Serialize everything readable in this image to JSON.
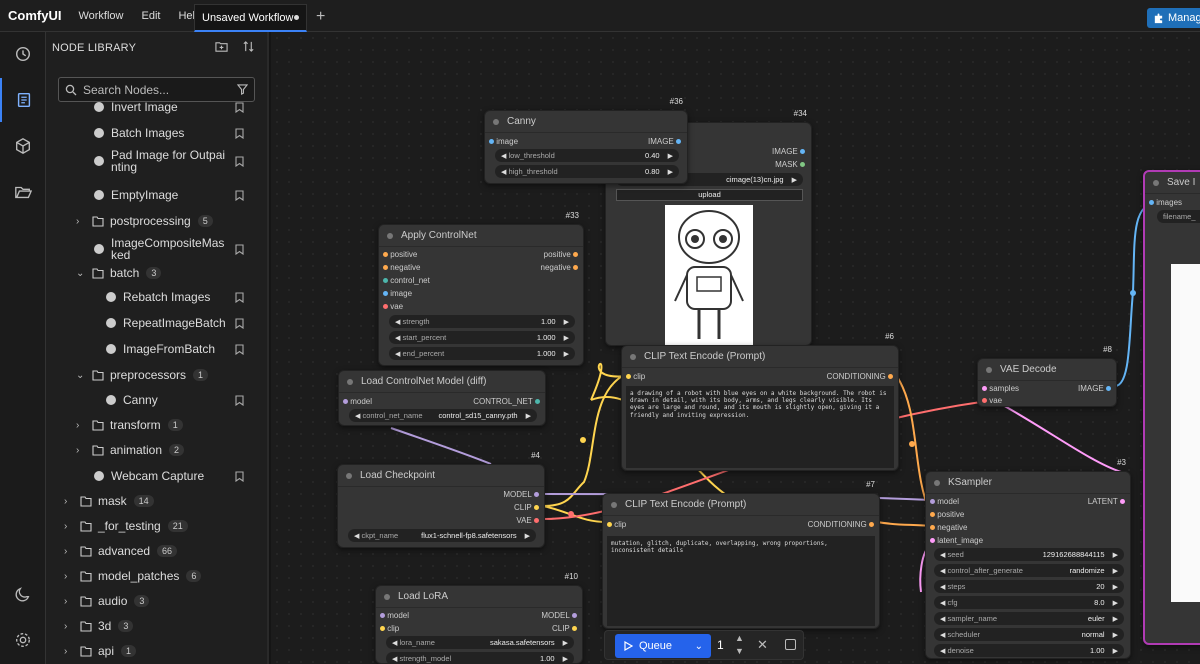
{
  "topbar": {
    "brand": "ComfyUI",
    "menus": [
      "Workflow",
      "Edit",
      "Help"
    ],
    "tab": "Unsaved Workflow",
    "add": "+",
    "manager": "Manag"
  },
  "library": {
    "title": "NODE LIBRARY",
    "search_placeholder": "Search Nodes...",
    "items": [
      {
        "label": "Invert Image",
        "indent": 1,
        "kind": "node"
      },
      {
        "label": "Batch Images",
        "indent": 1,
        "kind": "node"
      },
      {
        "label": "Pad Image for Outpainting",
        "indent": 1,
        "kind": "node",
        "two_line": [
          "Pad Image for Outpai",
          "nting"
        ]
      },
      {
        "label": "EmptyImage",
        "indent": 1,
        "kind": "node"
      },
      {
        "label": "postprocessing",
        "indent": 1,
        "kind": "folder",
        "open": false,
        "count": "5"
      },
      {
        "label": "ImageCompositeMasked",
        "indent": 1,
        "kind": "node",
        "two_line": [
          "ImageCompositeMas",
          "ked"
        ]
      },
      {
        "label": "batch",
        "indent": 1,
        "kind": "folder",
        "open": true,
        "count": "3"
      },
      {
        "label": "Rebatch Images",
        "indent": 2,
        "kind": "node"
      },
      {
        "label": "RepeatImageBatch",
        "indent": 2,
        "kind": "node"
      },
      {
        "label": "ImageFromBatch",
        "indent": 2,
        "kind": "node"
      },
      {
        "label": "preprocessors",
        "indent": 1,
        "kind": "folder",
        "open": true,
        "count": "1"
      },
      {
        "label": "Canny",
        "indent": 2,
        "kind": "node"
      },
      {
        "label": "transform",
        "indent": 1,
        "kind": "folder",
        "open": false,
        "count": "1"
      },
      {
        "label": "animation",
        "indent": 1,
        "kind": "folder",
        "open": false,
        "count": "2"
      },
      {
        "label": "Webcam Capture",
        "indent": 1,
        "kind": "node"
      },
      {
        "label": "mask",
        "indent": 0,
        "kind": "folder",
        "open": false,
        "count": "14"
      },
      {
        "label": "_for_testing",
        "indent": 0,
        "kind": "folder",
        "open": false,
        "count": "21"
      },
      {
        "label": "advanced",
        "indent": 0,
        "kind": "folder",
        "open": false,
        "count": "66"
      },
      {
        "label": "model_patches",
        "indent": 0,
        "kind": "folder",
        "open": false,
        "count": "6"
      },
      {
        "label": "audio",
        "indent": 0,
        "kind": "folder",
        "open": false,
        "count": "3"
      },
      {
        "label": "3d",
        "indent": 0,
        "kind": "folder",
        "open": false,
        "count": "3"
      },
      {
        "label": "api",
        "indent": 0,
        "kind": "folder",
        "open": false,
        "count": "1"
      }
    ]
  },
  "nodes": {
    "canny": {
      "id": "#36",
      "title": "Canny",
      "in": "image",
      "out": "IMAGE",
      "w1": [
        "low_threshold",
        "0.40"
      ],
      "w2": [
        "high_threshold",
        "0.80"
      ]
    },
    "loadimage": {
      "id": "#34",
      "out1": "IMAGE",
      "out2": "MASK",
      "file": "cimage(13)cn.jpg",
      "upload": "upload"
    },
    "apply": {
      "id": "#33",
      "title": "Apply ControlNet",
      "in": [
        "positive",
        "negative",
        "control_net",
        "image",
        "vae"
      ],
      "out": [
        "positive",
        "negative"
      ],
      "w": [
        [
          "strength",
          "1.00"
        ],
        [
          "start_percent",
          "1.000"
        ],
        [
          "end_percent",
          "1.000"
        ]
      ]
    },
    "controlnet": {
      "title": "Load ControlNet Model (diff)",
      "in": "model",
      "out": "CONTROL_NET",
      "w": [
        "control_net_name",
        "control_sd15_canny.pth"
      ]
    },
    "clip6": {
      "id": "#6",
      "title": "CLIP Text Encode (Prompt)",
      "in": "clip",
      "out": "CONDITIONING",
      "text": "a drawing of a robot with blue eyes on a white background. The robot is drawn in detail, with its body, arms, and legs clearly visible. Its eyes are large and round, and its mouth is slightly open, giving it a friendly and inviting expression."
    },
    "vaedecode": {
      "id": "#8",
      "title": "VAE Decode",
      "in": [
        "samples",
        "vae"
      ],
      "out": "IMAGE"
    },
    "checkpoint": {
      "id": "#4",
      "title": "Load Checkpoint",
      "out": [
        "MODEL",
        "CLIP",
        "VAE"
      ],
      "w": [
        "ckpt_name",
        "flux1-schnell-fp8.safetensors"
      ]
    },
    "clip7": {
      "id": "#7",
      "title": "CLIP Text Encode (Prompt)",
      "in": "clip",
      "out": "CONDITIONING",
      "text": "mutation, glitch, duplicate, overlapping, wrong proportions, inconsistent details"
    },
    "ksampler": {
      "id": "#3",
      "title": "KSampler",
      "in": [
        "model",
        "positive",
        "negative",
        "latent_image"
      ],
      "out": "LATENT",
      "w": [
        [
          "seed",
          "129162688844115"
        ],
        [
          "control_after_generate",
          "randomize"
        ],
        [
          "steps",
          "20"
        ],
        [
          "cfg",
          "8.0"
        ],
        [
          "sampler_name",
          "euler"
        ],
        [
          "scheduler",
          "normal"
        ],
        [
          "denoise",
          "1.00"
        ]
      ]
    },
    "lora": {
      "id": "#10",
      "title": "Load LoRA",
      "in": [
        "model",
        "clip"
      ],
      "out": [
        "MODEL",
        "CLIP"
      ],
      "w": [
        [
          "lora_name",
          "sakasa.safetensors"
        ],
        [
          "strength_model",
          "1.00"
        ]
      ]
    },
    "save": {
      "title": "Save I",
      "in": "images",
      "w": "filename_"
    }
  },
  "queue": {
    "label": "Queue",
    "count": "1"
  },
  "colors": {
    "accent": "#3b82f6",
    "model": "#b39ddb",
    "clip": "#ffd54f",
    "vae": "#ff6e6e",
    "cond": "#ffa94d",
    "image": "#64b5f6",
    "latent": "#ff9cf9"
  }
}
